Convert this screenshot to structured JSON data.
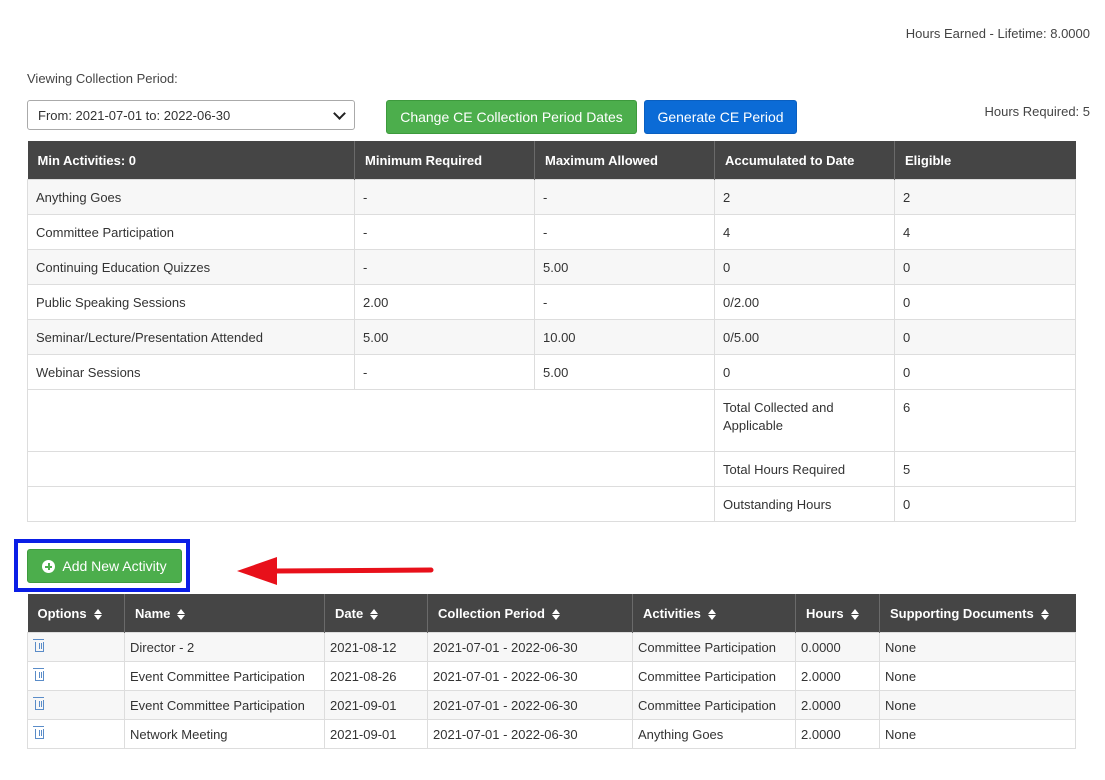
{
  "header": {
    "hours_earned": "Hours Earned - Lifetime: 8.0000",
    "viewing_label": "Viewing Collection Period:",
    "period_value": "From: 2021-07-01 to: 2022-06-30",
    "change_button": "Change CE Collection Period Dates",
    "generate_button": "Generate CE Period",
    "hours_required": "Hours Required:  5"
  },
  "summary": {
    "headers": [
      "Min Activities: 0",
      "Minimum Required",
      "Maximum Allowed",
      "Accumulated to Date",
      "Eligible"
    ],
    "rows": [
      {
        "activity": "Anything Goes",
        "min": "-",
        "max": "-",
        "accumulated": "2",
        "eligible": "2"
      },
      {
        "activity": "Committee Participation",
        "min": "-",
        "max": "-",
        "accumulated": "4",
        "eligible": "4"
      },
      {
        "activity": "Continuing Education Quizzes",
        "min": "-",
        "max": "5.00",
        "accumulated": "0",
        "eligible": "0"
      },
      {
        "activity": "Public Speaking Sessions",
        "min": "2.00",
        "max": "-",
        "accumulated": "0/2.00",
        "eligible": "0"
      },
      {
        "activity": "Seminar/Lecture/Presentation Attended",
        "min": "5.00",
        "max": "10.00",
        "accumulated": "0/5.00",
        "eligible": "0"
      },
      {
        "activity": "Webinar Sessions",
        "min": "-",
        "max": "5.00",
        "accumulated": "0",
        "eligible": "0"
      }
    ],
    "totals": [
      {
        "label": "Total Collected and Applicable",
        "value": "6"
      },
      {
        "label": "Total Hours Required",
        "value": "5"
      },
      {
        "label": "Outstanding Hours",
        "value": "0"
      }
    ],
    "warning_color": "#e31b1b"
  },
  "add_button": "Add New Activity",
  "activities": {
    "headers": [
      "Options",
      "Name",
      "Date",
      "Collection Period",
      "Activities",
      "Hours",
      "Supporting Documents"
    ],
    "rows": [
      {
        "name": "Director - 2",
        "date": "2021-08-12",
        "period": "2021-07-01 - 2022-06-30",
        "activity": "Committee Participation",
        "hours": "0.0000",
        "docs": "None"
      },
      {
        "name": "Event Committee Participation",
        "date": "2021-08-26",
        "period": "2021-07-01 - 2022-06-30",
        "activity": "Committee Participation",
        "hours": "2.0000",
        "docs": "None"
      },
      {
        "name": "Event Committee Participation",
        "date": "2021-09-01",
        "period": "2021-07-01 - 2022-06-30",
        "activity": "Committee Participation",
        "hours": "2.0000",
        "docs": "None"
      },
      {
        "name": "Network Meeting",
        "date": "2021-09-01",
        "period": "2021-07-01 - 2022-06-30",
        "activity": "Anything Goes",
        "hours": "2.0000",
        "docs": "None"
      }
    ]
  },
  "colors": {
    "header_bg": "#454545",
    "green_button": "#4cae4c",
    "blue_button": "#0b6bd6",
    "highlight_box": "#0a1ee6",
    "arrow": "#e8101a"
  },
  "icons": [
    "chevron-down-icon",
    "plus-circle-icon",
    "sort-icon",
    "trash-icon",
    "red-arrow-annotation"
  ]
}
